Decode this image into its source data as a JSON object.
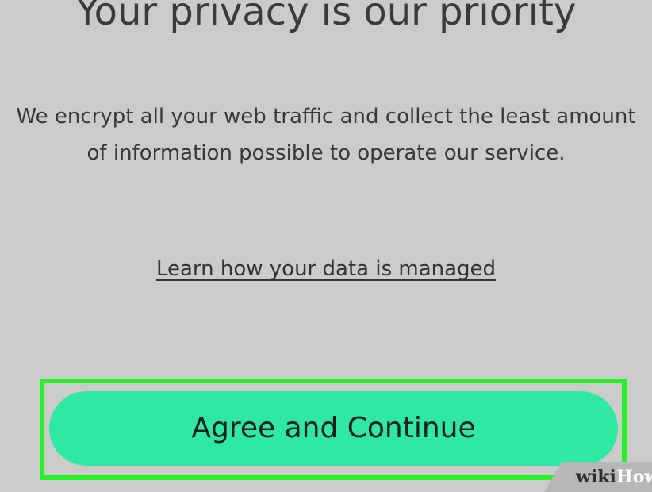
{
  "title": "Your privacy is our priority",
  "description": "We encrypt all your web traffic and collect the least amount of information possible to operate our service.",
  "learn_link": "Learn how your data is managed",
  "agree_button": "Agree and Continue",
  "watermark": {
    "wiki": "wiki",
    "how": "How"
  },
  "colors": {
    "background": "#cbcbcb",
    "button": "#2ee8a4",
    "highlight": "#27f027"
  }
}
